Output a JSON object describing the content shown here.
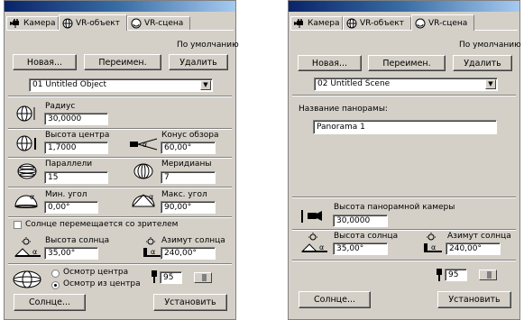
{
  "left": {
    "tabs": [
      "Камера",
      "VR-объект",
      "VR-сцена"
    ],
    "default_label": "По умолчанию",
    "buttons": {
      "new": "Новая...",
      "rename": "Переимен.",
      "delete": "Удалить"
    },
    "object_select": "01  Untitled Object",
    "radius": {
      "label": "Радиус",
      "value": "30,0000"
    },
    "center_height": {
      "label": "Высота центра",
      "value": "1,7000"
    },
    "view_cone": {
      "label": "Конус обзора",
      "value": "60,00°"
    },
    "parallels": {
      "label": "Параллели",
      "value": "15"
    },
    "meridians": {
      "label": "Меридианы",
      "value": "7"
    },
    "min_angle": {
      "label": "Мин. угол",
      "value": "0,00°"
    },
    "max_angle": {
      "label": "Макс. угол",
      "value": "90,00°"
    },
    "sun_moves": "Солнце перемещается со зрителем",
    "sun_height": {
      "label": "Высота солнца",
      "value": "35,00°"
    },
    "sun_azimuth": {
      "label": "Азимут солнца",
      "value": "240,00°"
    },
    "radio_center": "Осмотр центра",
    "radio_from_center": "Осмотр из центра",
    "quality": "95",
    "sun_button": "Солнце...",
    "set_button": "Установить"
  },
  "right": {
    "tabs": [
      "Камера",
      "VR-объект",
      "VR-сцена"
    ],
    "default_label": "По умолчанию",
    "buttons": {
      "new": "Новая...",
      "rename": "Переимен.",
      "delete": "Удалить"
    },
    "scene_select": "02  Untitled Scene",
    "pano_name_label": "Название панорамы:",
    "pano_name_value": "Panorama 1",
    "cam_height": {
      "label": "Высота панорамной камеры",
      "value": "30,0000"
    },
    "sun_height": {
      "label": "Высота солнца",
      "value": "35,00°"
    },
    "sun_azimuth": {
      "label": "Азимут солнца",
      "value": "240,00°"
    },
    "quality": "95",
    "sun_button": "Солнце...",
    "set_button": "Установить"
  }
}
